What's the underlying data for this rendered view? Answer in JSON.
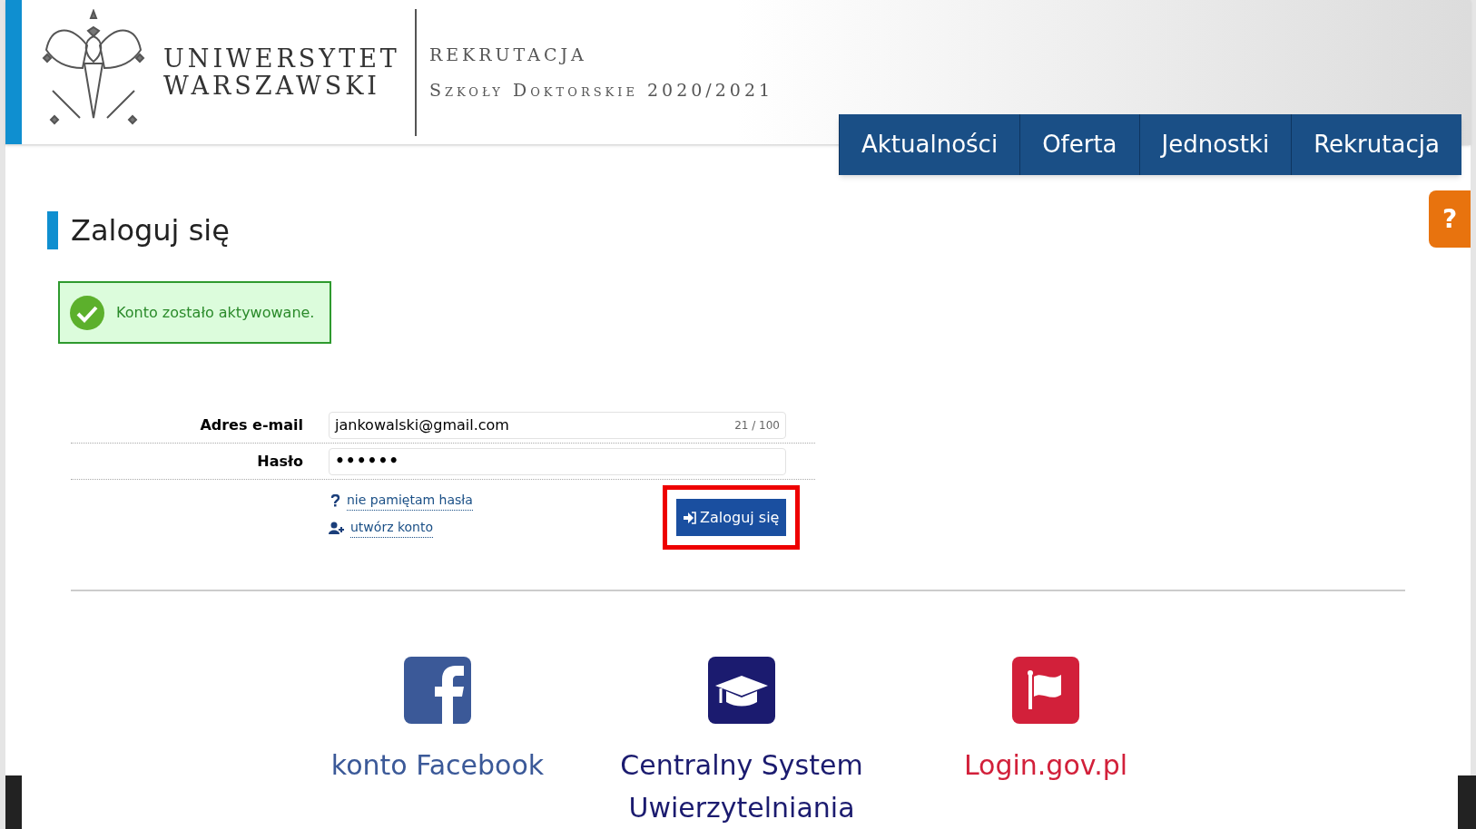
{
  "header": {
    "university": [
      "UNIWERSYTET",
      "WARSZAWSKI"
    ],
    "title": "REKRUTACJA",
    "subtitle": "Szkoły Doktorskie 2020/2021"
  },
  "nav": [
    "Aktualności",
    "Oferta",
    "Jednostki",
    "Rekrutacja"
  ],
  "help_button": "?",
  "page_title": "Zaloguj się",
  "alert": {
    "kind": "success",
    "text": "Konto zostało aktywowane."
  },
  "form": {
    "fields": [
      {
        "label": "Adres e-mail",
        "kind": "text",
        "value": "jankowalski@gmail.com",
        "counter": "21 / 100"
      },
      {
        "label": "Hasło",
        "kind": "password",
        "value": "••••••"
      }
    ],
    "links": [
      {
        "kind": "help",
        "label": "nie pamiętam hasła"
      },
      {
        "kind": "add-user",
        "label": "utwórz konto"
      }
    ],
    "submit": {
      "label": "Zaloguj się",
      "highlighted": true
    }
  },
  "login_options": [
    {
      "kind": "facebook",
      "label": "konto Facebook",
      "color": "#3b5998"
    },
    {
      "kind": "cap",
      "label": "Centralny System Uwierzytelniania",
      "color": "#1b1b6f"
    },
    {
      "kind": "flag",
      "label": "Login.gov.pl",
      "color": "#d2203a"
    }
  ]
}
